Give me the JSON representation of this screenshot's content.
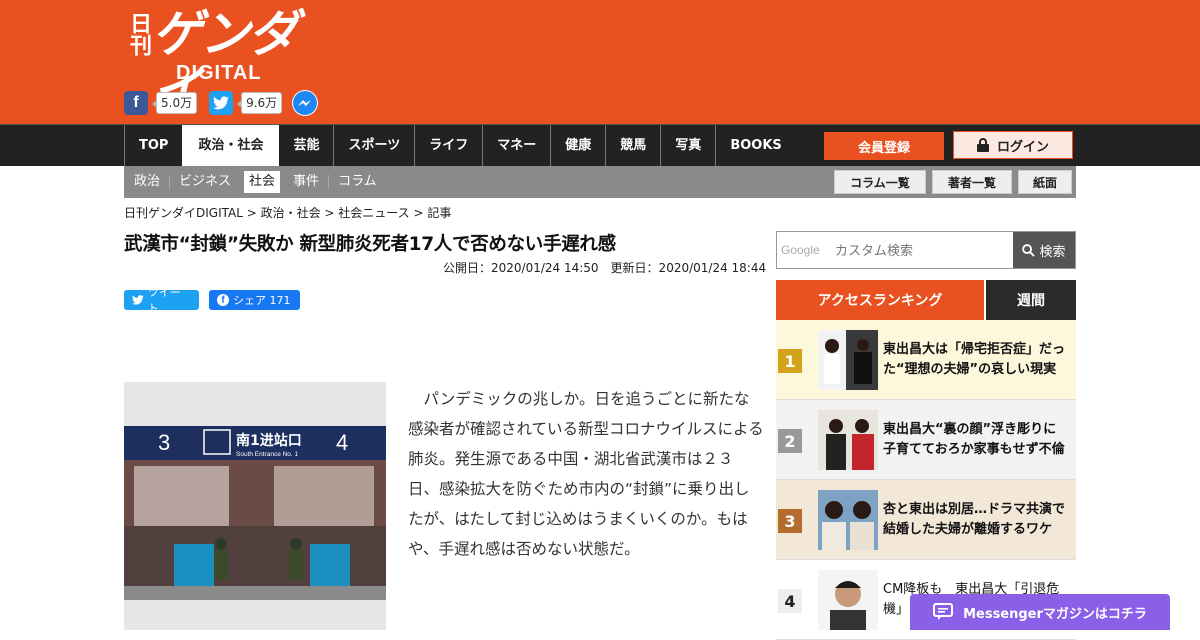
{
  "logo": {
    "nikkan": "日刊",
    "gendai": "ゲンダイ",
    "digital": "DIGITAL"
  },
  "social": {
    "facebook_count": "5.0万",
    "twitter_count": "9.6万",
    "facebook_glyph": "f"
  },
  "nav": {
    "items": [
      "TOP",
      "政治・社会",
      "芸能",
      "スポーツ",
      "ライフ",
      "マネー",
      "健康",
      "競馬",
      "写真",
      "BOOKS"
    ],
    "register": "会員登録",
    "login": "ログイン"
  },
  "subnav": {
    "items": [
      "政治",
      "ビジネス",
      "社会",
      "事件",
      "コラム"
    ],
    "buttons": [
      "コラム一覧",
      "著者一覧",
      "紙面"
    ]
  },
  "breadcrumb": "日刊ゲンダイDIGITAL > 政治・社会 > 社会ニュース > 記事",
  "article": {
    "title": "武漢市“封鎖”失敗か 新型肺炎死者17人で否めない手遅れ感",
    "dates": "公開日：2020/01/24 14:50　更新日：2020/01/24 18:44",
    "tweet": "ツイート",
    "share": "シェア 171",
    "body": "パンデミックの兆しか。日を追うごとに新たな感染者が確認されている新型コロナウイルスによる肺炎。発生源である中国・湖北省武漢市は２３日、感染拡大を防ぐため市内の“封鎖”に乗り出したが、はたして封じ込めはうまくいくのか。もはや、手遅れ感は否めない状態だ。"
  },
  "photo": {
    "sign_left": "3",
    "sign_main": "南1进站口",
    "sign_sub": "South Entrance No. 1",
    "sign_right": "4"
  },
  "search": {
    "google": "Google",
    "placeholder": "カスタム検索",
    "button": "検索"
  },
  "ranking": {
    "tab_access": "アクセスランキング",
    "tab_weekly": "週間",
    "items": [
      {
        "num": "1",
        "text": "東出昌大は「帰宅拒否症」だった“理想の夫婦”の哀しい現実"
      },
      {
        "num": "2",
        "text": "東出昌大“裏の顔”浮き彫りに 子育てておろか家事もせず不倫"
      },
      {
        "num": "3",
        "text": "杏と東出は別居…ドラマ共演で結婚した夫婦が離婚するワケ"
      },
      {
        "num": "4",
        "text": "CM降板も　東出昌大「引退危機」"
      }
    ]
  },
  "messenger": "Messengerマガジンはコチラ",
  "colors": {
    "brand": "#e95120",
    "nav": "#222222",
    "subnav": "#8a8a8a",
    "messenger": "#8a60e8"
  }
}
